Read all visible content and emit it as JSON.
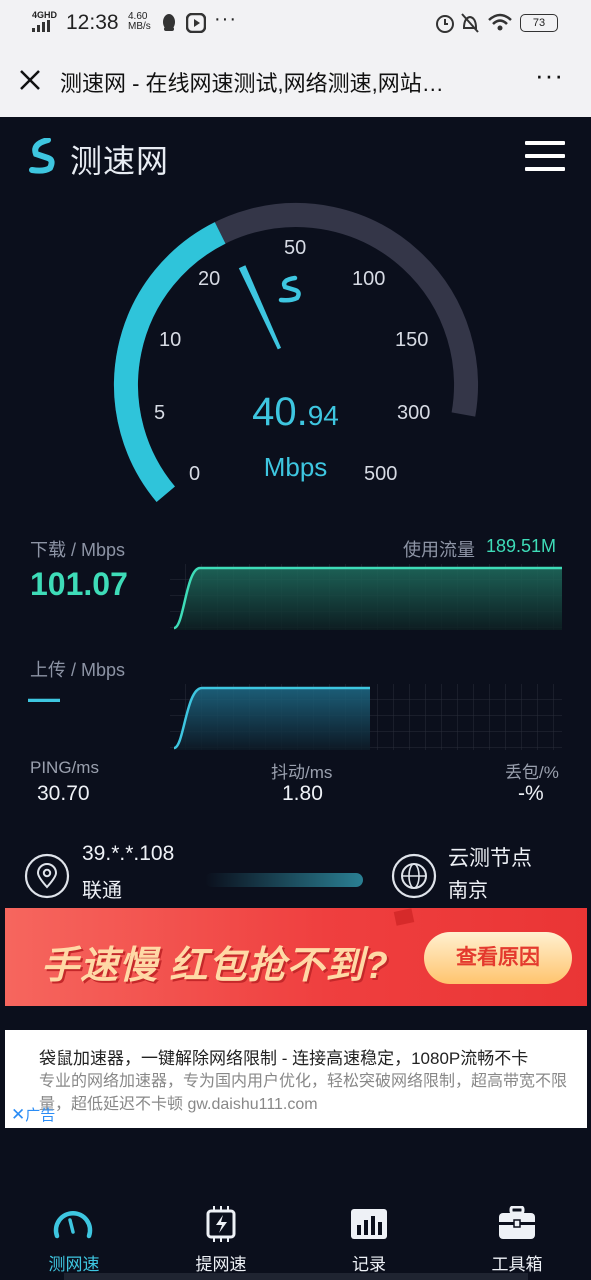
{
  "status_bar": {
    "network": "4GHD",
    "time": "12:38",
    "speed_value": "4.60",
    "speed_unit": "MB/s",
    "more_indicator": "···",
    "battery": "73"
  },
  "browser": {
    "title": "测速网 - 在线网速测试,网络测速,网站…",
    "more": "···"
  },
  "header": {
    "logo_text": "测速网"
  },
  "gauge": {
    "ticks": [
      "0",
      "5",
      "10",
      "20",
      "50",
      "100",
      "150",
      "300",
      "500"
    ],
    "speed_int": "40.",
    "speed_dec": "94",
    "unit": "Mbps",
    "progress_fraction": 0.45,
    "needle_value": 44
  },
  "download": {
    "label": "下载 / Mbps",
    "value": "101.07",
    "usage_label": "使用流量",
    "usage_value": "189.51M"
  },
  "upload": {
    "label": "上传 / Mbps",
    "value": "—"
  },
  "stats": {
    "ping_label": "PING/ms",
    "ping_value": "30.70",
    "jitter_label": "抖动/ms",
    "jitter_value": "1.80",
    "loss_label": "丢包/%",
    "loss_value": "-%"
  },
  "connection": {
    "ip": "39.*.*.108",
    "isp": "联通",
    "node_label": "云测节点",
    "node_city": "南京"
  },
  "banner": {
    "text": "手速慢 红包抢不到?",
    "button": "查看原因"
  },
  "ad": {
    "line1": "袋鼠加速器，一键解除网络限制 - 连接高速稳定，1080P流畅不卡",
    "line2": "专业的网络加速器，专为国内用户优化，轻松突破网络限制，超高带宽不限量，超低延迟不卡顿 gw.daishu111.com",
    "tag": "广告"
  },
  "tabs": [
    {
      "label": "测网速",
      "icon": "speedometer-icon",
      "active": true
    },
    {
      "label": "提网速",
      "icon": "chip-icon",
      "active": false
    },
    {
      "label": "记录",
      "icon": "bar-chart-icon",
      "active": false
    },
    {
      "label": "工具箱",
      "icon": "toolbox-icon",
      "active": false
    }
  ],
  "colors": {
    "accent": "#3ec6e0",
    "download": "#3edcb8",
    "background": "#0b0f1c"
  }
}
